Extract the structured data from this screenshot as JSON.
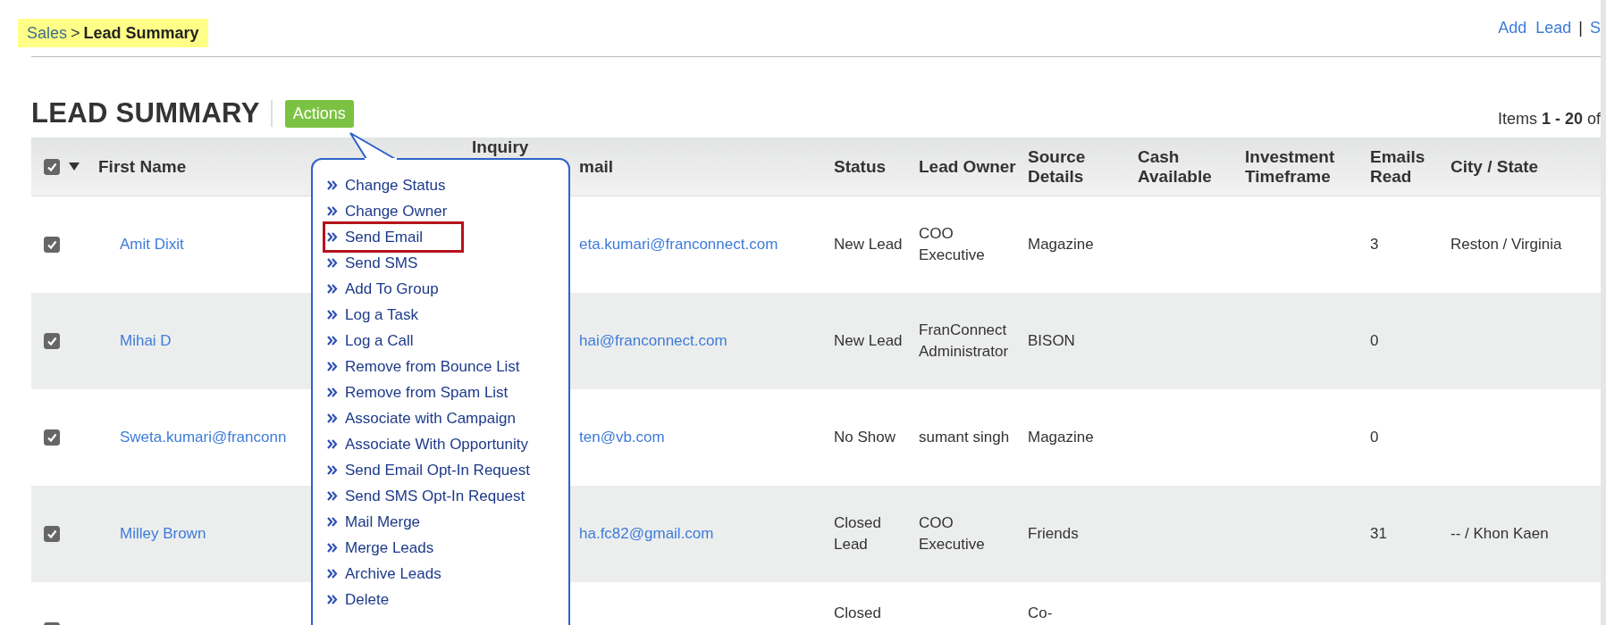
{
  "breadcrumb": {
    "parent": "Sales",
    "separator": ">",
    "current": "Lead Summary"
  },
  "top_links": [
    {
      "label": "Add  Lead"
    },
    {
      "label": "S"
    }
  ],
  "top_link_separator": "|",
  "title": "LEAD SUMMARY",
  "actions_button": "Actions",
  "pagination": "Items **1 - 20** of",
  "table": {
    "select_all_checked": true,
    "columns": [
      "First Name",
      "Inquiry",
      "mail",
      "Status",
      "Lead Owner",
      "Source Details",
      "Cash Available",
      "Investment Timeframe",
      "Emails Read",
      "City  / State"
    ],
    "rows": [
      {
        "checked": true,
        "cells": [
          "Amit Dixit",
          "",
          "eta.kumari@franconnect.com",
          "New Lead",
          "COO Executive",
          "Magazine",
          "",
          "",
          "3",
          "Reston / Virginia"
        ]
      },
      {
        "checked": true,
        "cells": [
          "Mihai D",
          "",
          "hai@franconnect.com",
          "New Lead",
          "FranConnect Administrator",
          "BISON",
          "",
          "",
          "0",
          ""
        ]
      },
      {
        "checked": true,
        "cells": [
          "Sweta.kumari@franconn",
          "",
          "ten@vb.com",
          "No Show",
          "sumant singh",
          "Magazine",
          "",
          "",
          "0",
          ""
        ]
      },
      {
        "checked": true,
        "cells": [
          "Milley Brown",
          "",
          "ha.fc82@gmail.com",
          "Closed Lead",
          "COO Executive",
          "Friends",
          "",
          "",
          "31",
          "-- / Khon Kaen"
        ]
      },
      {
        "checked": true,
        "cells": [
          "",
          "",
          "",
          "Closed",
          "",
          "Co-",
          "",
          "",
          "",
          ""
        ]
      }
    ]
  },
  "actions_menu": [
    {
      "label": "Change Status",
      "highlighted": false
    },
    {
      "label": "Change Owner",
      "highlighted": false
    },
    {
      "label": "Send Email",
      "highlighted": true
    },
    {
      "label": "Send SMS",
      "highlighted": false
    },
    {
      "label": "Add To Group",
      "highlighted": false
    },
    {
      "label": "Log a Task",
      "highlighted": false
    },
    {
      "label": "Log a Call",
      "highlighted": false
    },
    {
      "label": "Remove from Bounce List",
      "highlighted": false
    },
    {
      "label": "Remove from Spam List",
      "highlighted": false
    },
    {
      "label": "Associate with Campaign",
      "highlighted": false
    },
    {
      "label": "Associate With Opportunity",
      "highlighted": false
    },
    {
      "label": "Send Email Opt-In Request",
      "highlighted": false
    },
    {
      "label": "Send SMS Opt-In Request",
      "highlighted": false
    },
    {
      "label": "Mail Merge",
      "highlighted": false
    },
    {
      "label": "Merge Leads",
      "highlighted": false
    },
    {
      "label": "Archive Leads",
      "highlighted": false
    },
    {
      "label": "Delete",
      "highlighted": false
    }
  ]
}
